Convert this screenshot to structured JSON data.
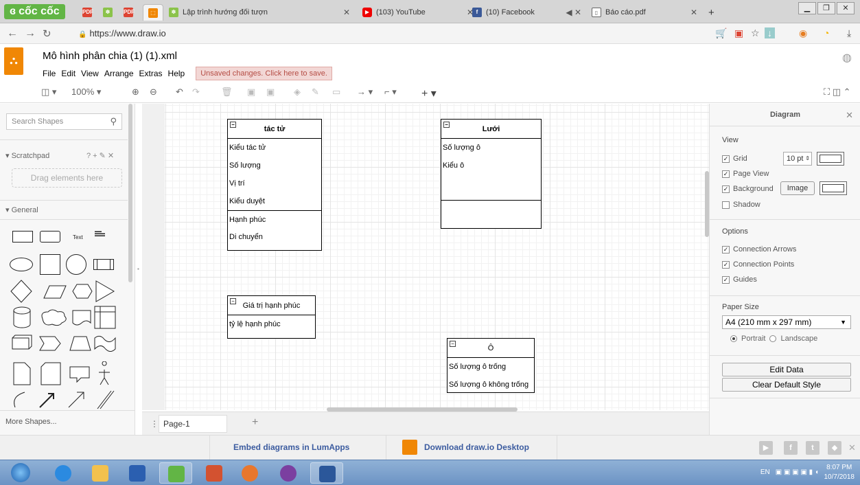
{
  "browser": {
    "brand": "cốc cốc",
    "tabs": [
      {
        "label": "Lập trình hướng đối tượn",
        "favicon": "draw-io-favicon"
      },
      {
        "label": "(103) YouTube",
        "favicon": "youtube-favicon"
      },
      {
        "label": "(10) Facebook",
        "favicon": "facebook-favicon"
      },
      {
        "label": "Báo cáo.pdf",
        "favicon": "pdf-favicon"
      }
    ],
    "new_tab": "+",
    "url": "https://www.draw.io"
  },
  "app": {
    "title": "Mô hình phân chia (1) (1).xml",
    "menu": [
      "File",
      "Edit",
      "View",
      "Arrange",
      "Extras",
      "Help"
    ],
    "unsaved": "Unsaved changes. Click here to save.",
    "zoom": "100%"
  },
  "left": {
    "search_placeholder": "Search Shapes",
    "scratchpad": "Scratchpad",
    "scratch_icons": "? + ✎ ✕",
    "drag_hint": "Drag elements here",
    "general": "General",
    "text_shape": "Text",
    "more_shapes": "More Shapes..."
  },
  "canvas": {
    "classes": [
      {
        "name": "tác tử",
        "attrs": [
          "Kiểu tác tử",
          "Số lượng",
          "Vị trí",
          "Kiểu duyệt"
        ],
        "methods": [
          "Hạnh phúc",
          "Di chuyển"
        ]
      },
      {
        "name": "Lưới",
        "attrs": [
          "Số lượng ô",
          "Kiểu ô"
        ],
        "methods": []
      },
      {
        "name": "Giá trị hạnh phúc",
        "attrs": [
          "tỷ lệ hạnh phúc"
        ],
        "methods": []
      },
      {
        "name": "Ô",
        "attrs": [
          "Số lượng ô trống",
          "Số lượng ô không trống"
        ],
        "methods": []
      }
    ]
  },
  "right": {
    "title": "Diagram",
    "view": "View",
    "grid": "Grid",
    "grid_size": "10 pt",
    "page_view": "Page View",
    "background": "Background",
    "image_btn": "Image",
    "shadow": "Shadow",
    "options": "Options",
    "conn_arrows": "Connection Arrows",
    "conn_points": "Connection Points",
    "guides": "Guides",
    "paper_size": "Paper Size",
    "paper": "A4 (210 mm x 297 mm)",
    "portrait": "Portrait",
    "landscape": "Landscape",
    "edit_data": "Edit Data",
    "clear_style": "Clear Default Style"
  },
  "pages": {
    "tab": "Page-1",
    "add": "+"
  },
  "footer": {
    "embed": "Embed diagrams in LumApps",
    "download": "Download draw.io Desktop"
  },
  "taskbar": {
    "lang": "EN",
    "time": "8:07 PM",
    "date": "10/7/2018"
  }
}
